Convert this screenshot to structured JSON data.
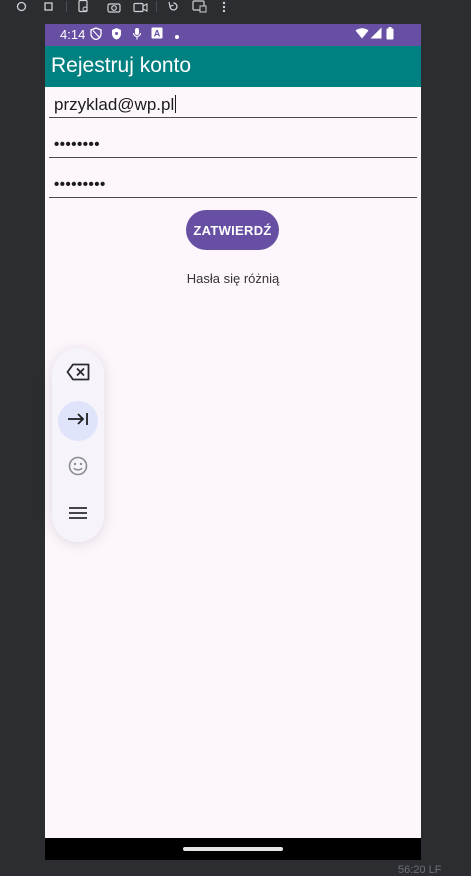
{
  "status": {
    "time": "4:14"
  },
  "app": {
    "title": "Rejestruj konto"
  },
  "form": {
    "email_value": "przyklad@wp.pl",
    "password_value": "••••••••",
    "confirm_value": "•••••••••",
    "submit_label": "ZATWIERDŹ",
    "message": "Hasła się różnią"
  },
  "ide": {
    "bottom_status": "56:20 LF"
  },
  "colors": {
    "status_bar": "#6750a4",
    "app_bar": "#008080",
    "button": "#6750a4",
    "background": "#fdf7fd"
  },
  "icons": {
    "ide_toolbar": [
      "circle-icon",
      "square-icon",
      "device-settings-icon",
      "camera-icon",
      "video-icon",
      "rotate-icon",
      "device-screen-icon",
      "more-vert-icon"
    ],
    "keyboard_toolbar": [
      "backspace-icon",
      "tab-arrow-icon",
      "emoji-icon",
      "menu-icon"
    ]
  }
}
